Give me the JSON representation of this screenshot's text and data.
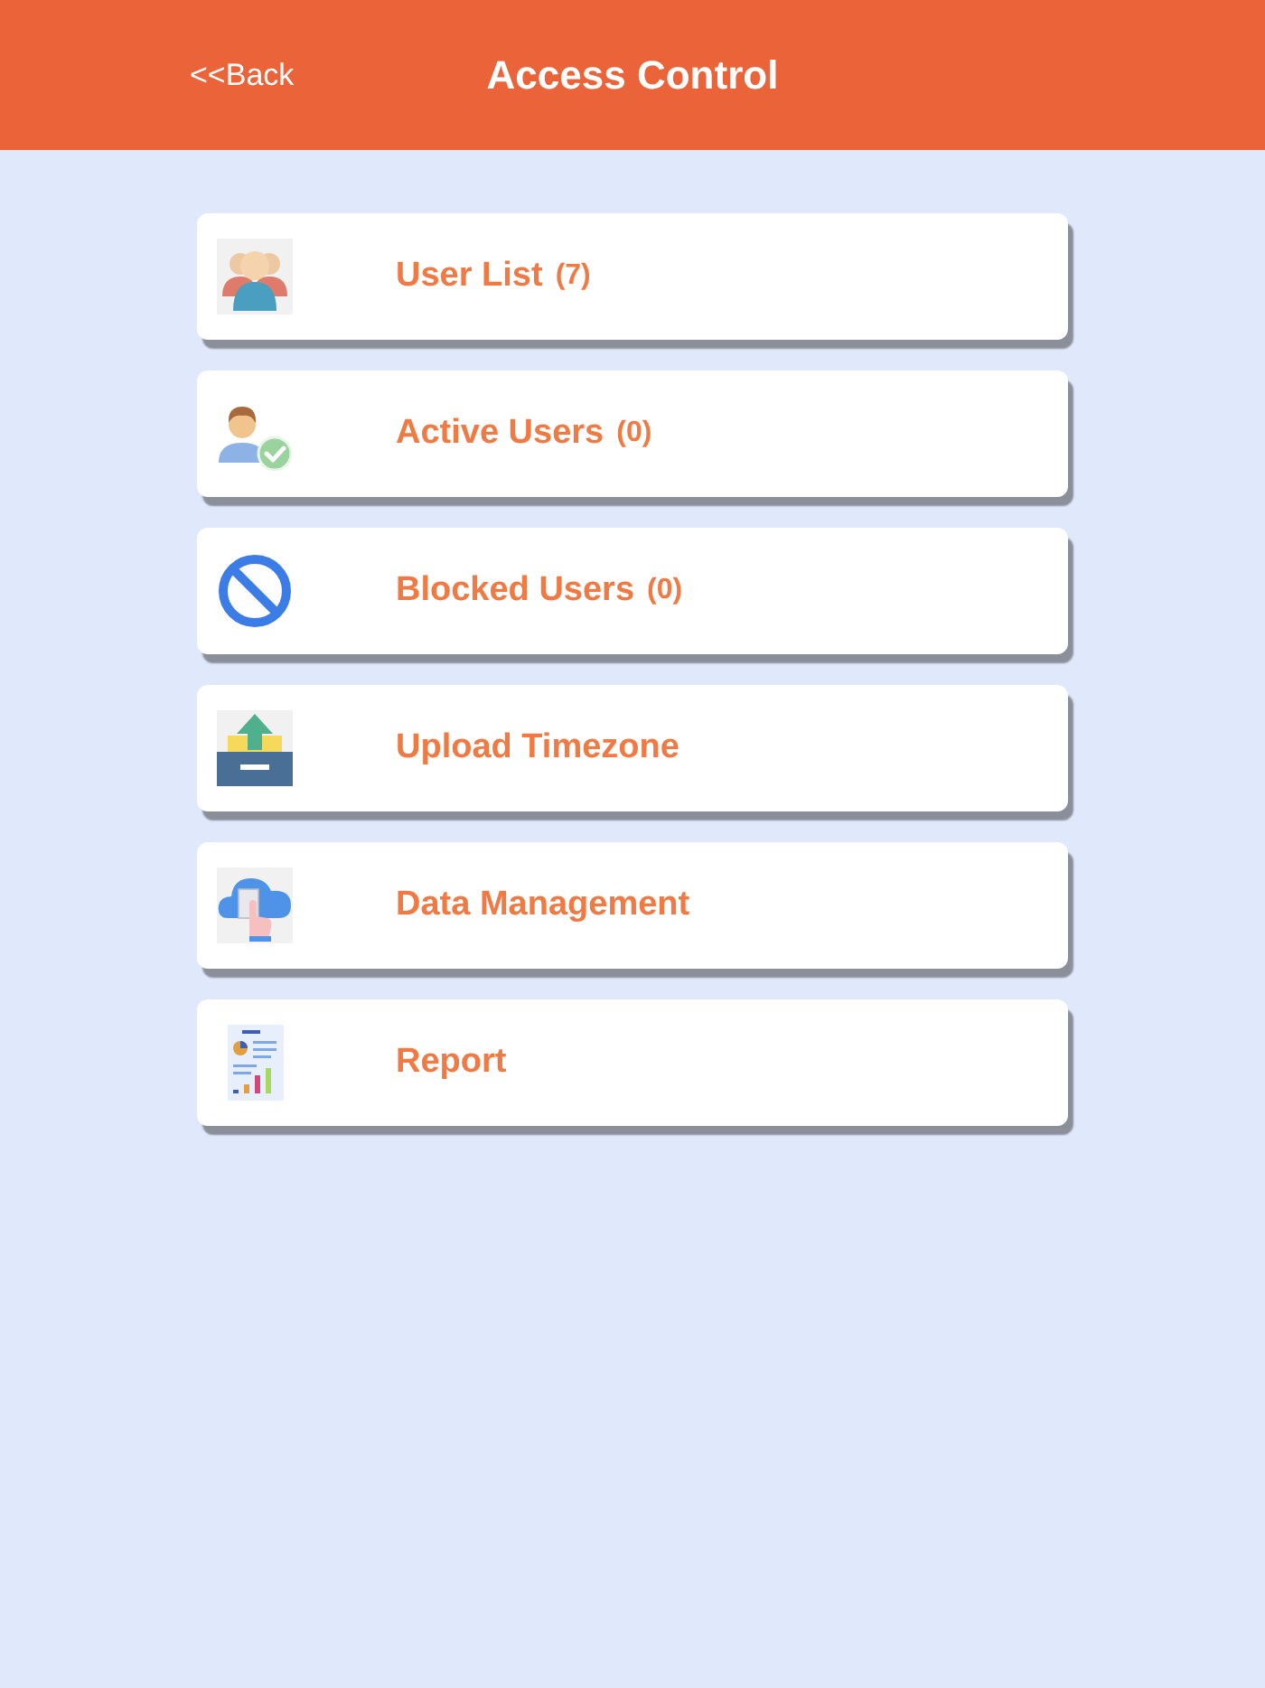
{
  "header": {
    "back": "<<Back",
    "title": "Access Control"
  },
  "items": [
    {
      "kind": "users",
      "label": "User List",
      "count": "(7)"
    },
    {
      "kind": "active",
      "label": "Active Users",
      "count": "(0)"
    },
    {
      "kind": "blocked",
      "label": "Blocked Users",
      "count": "(0)"
    },
    {
      "kind": "upload",
      "label": "Upload Timezone"
    },
    {
      "kind": "data",
      "label": "Data Management"
    },
    {
      "kind": "report",
      "label": "Report"
    }
  ]
}
